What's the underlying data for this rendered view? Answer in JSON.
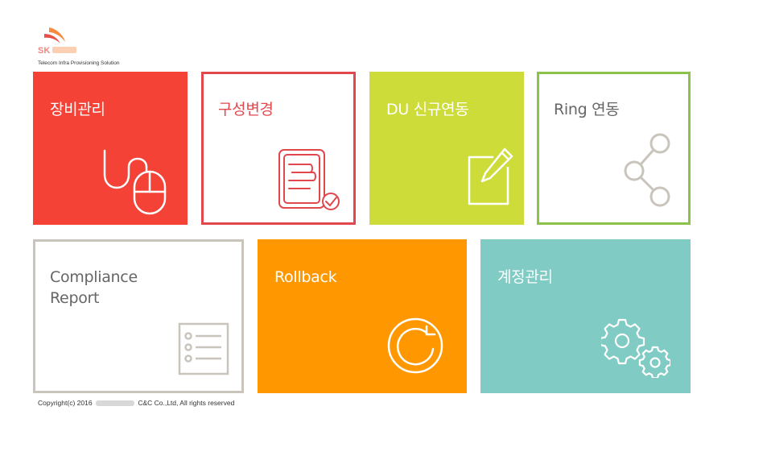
{
  "header": {
    "logo_text": "SK",
    "logo_subtitle": "Telecom Infra Provisioning Solution"
  },
  "tiles": [
    {
      "id": "equipment",
      "label": "장비관리",
      "icon": "mouse-icon",
      "color": "#f44336",
      "text_color": "#ffffff"
    },
    {
      "id": "config",
      "label": "구성변경",
      "icon": "document-check-icon",
      "color": "#e0484e",
      "text_color": "#e0484e"
    },
    {
      "id": "du",
      "label": "DU 신규연동",
      "icon": "edit-note-icon",
      "color": "#cddc39",
      "text_color": "#ffffff"
    },
    {
      "id": "ring",
      "label": "Ring 연동",
      "icon": "share-nodes-icon",
      "color": "#8bc34a",
      "text_color": "#666666"
    },
    {
      "id": "compliance",
      "label": "Compliance\nReport",
      "icon": "checklist-icon",
      "color": "#c9c5bc",
      "text_color": "#666666"
    },
    {
      "id": "rollback",
      "label": "Rollback",
      "icon": "refresh-icon",
      "color": "#ff9800",
      "text_color": "#ffffff"
    },
    {
      "id": "account",
      "label": "계정관리",
      "icon": "gears-icon",
      "color": "#80cbc4",
      "text_color": "#ffffff"
    }
  ],
  "footer": {
    "prefix": "Copyright(c) 2016",
    "suffix": "C&C Co.,Ltd, All rights reserved"
  }
}
